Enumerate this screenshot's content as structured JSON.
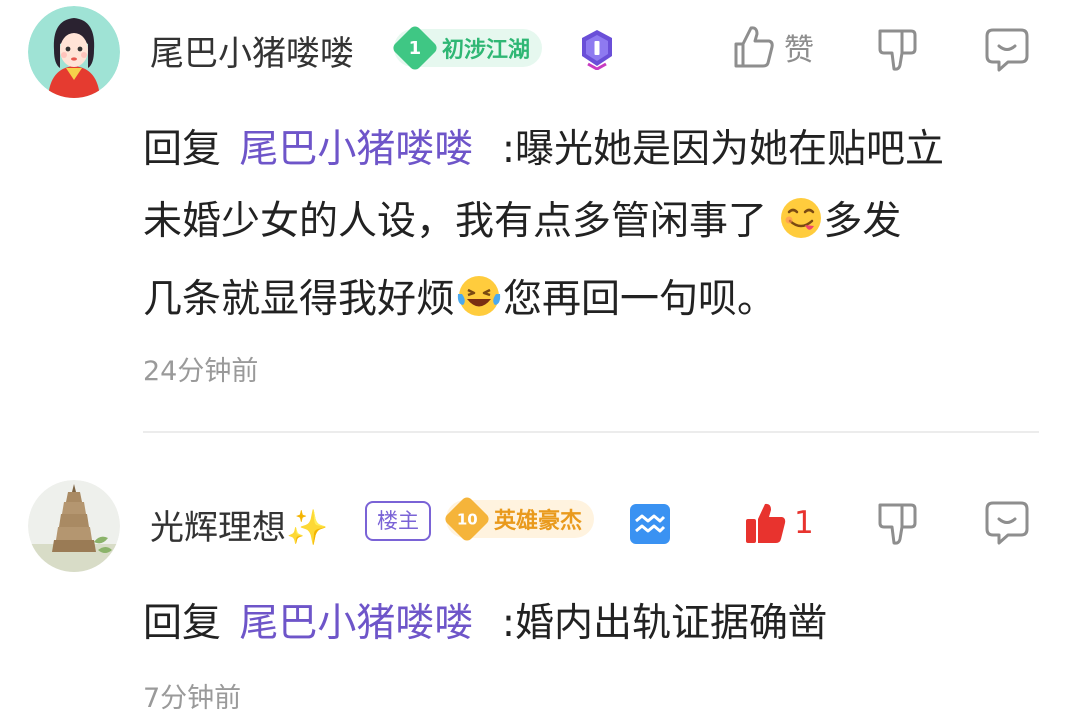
{
  "comments": [
    {
      "username": "尾巴小猪喽喽",
      "level_number": "1",
      "level_title": "初涉江湖",
      "like_label": "赞",
      "reply_prefix": "回复",
      "mention": "尾巴小猪喽喽",
      "text_part1": ":曝光她是因为她在贴吧立",
      "text_part2": "未婚少女的人设，我有点多管闲事了",
      "text_part3": "多发",
      "text_part4": "几条就显得我好烦",
      "text_part5": "您再回一句呗。",
      "time": "24分钟前"
    },
    {
      "username": "光辉理想✨",
      "owner_badge": "楼主",
      "level_number": "10",
      "level_title": "英雄豪杰",
      "like_count": "1",
      "reply_prefix": "回复",
      "mention": "尾巴小猪喽喽",
      "text": ":婚内出轨证据确凿",
      "time": "7分钟前"
    }
  ],
  "colors": {
    "mention": "#6e55c9",
    "liked": "#e8332e",
    "level1_bg": "#e6f8ef",
    "level1_text": "#2fb774",
    "level10_bg": "#fff3df",
    "level10_text": "#e99a1d",
    "owner_badge": "#7a63d6",
    "icon_gray": "#8e8e8e"
  },
  "icons": [
    "thumbs-up-icon",
    "thumbs-down-icon",
    "reply-bubble-icon",
    "rank-medal-icon",
    "zodiac-aquarius-icon",
    "laughing-tears-emoji",
    "yum-emoji"
  ]
}
